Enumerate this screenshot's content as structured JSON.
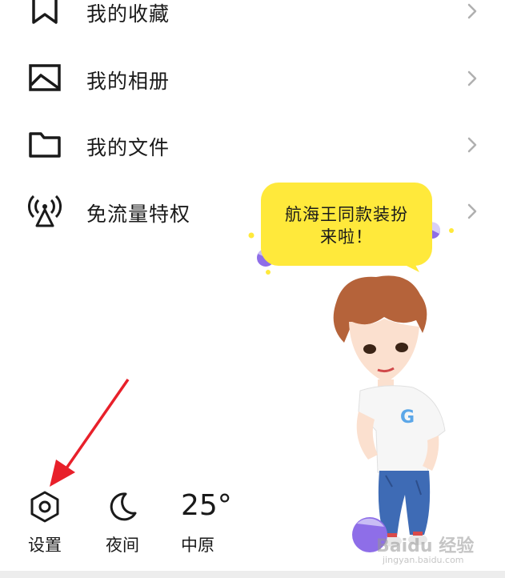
{
  "menu": {
    "items": [
      {
        "label": "我的收藏",
        "icon": "bookmark-icon"
      },
      {
        "label": "我的相册",
        "icon": "image-icon"
      },
      {
        "label": "我的文件",
        "icon": "folder-icon"
      },
      {
        "label": "免流量特权",
        "icon": "antenna-icon"
      }
    ]
  },
  "promo": {
    "bubble_text": "航海王同款装扮\n来啦！",
    "bubble_color": "#ffe93b",
    "accent_color": "#8e6ee8"
  },
  "bottom": {
    "settings_label": "设置",
    "night_label": "夜间",
    "temperature": "25°",
    "city": "中原"
  },
  "watermark": {
    "brand": "Baidu 经验",
    "sub": "jingyan.baidu.com"
  }
}
